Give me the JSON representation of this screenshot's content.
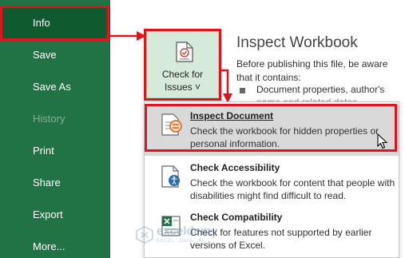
{
  "nav": {
    "items": [
      {
        "label": "Info",
        "state": "selected"
      },
      {
        "label": "Save",
        "state": "enabled"
      },
      {
        "label": "Save As",
        "state": "enabled"
      },
      {
        "label": "History",
        "state": "disabled"
      },
      {
        "label": "Print",
        "state": "enabled"
      },
      {
        "label": "Share",
        "state": "enabled"
      },
      {
        "label": "Export",
        "state": "enabled"
      },
      {
        "label": "More...",
        "state": "enabled"
      }
    ]
  },
  "check_issues": {
    "label_line1": "Check for",
    "label_line2": "Issues ˅",
    "icon": "document-checklist-icon"
  },
  "inspect": {
    "title": "Inspect Workbook",
    "description": "Before publishing this file, be aware that it contains:",
    "bullet": "Document properties, author's",
    "bullet_partial": "name and related dates"
  },
  "menu": {
    "items": [
      {
        "title": "Inspect Document",
        "description": "Check the workbook for hidden properties or personal information.",
        "icon": "inspect-document-icon",
        "highlighted": true
      },
      {
        "title": "Check Accessibility",
        "description": "Check the workbook for content that people with disabilities might find difficult to read.",
        "icon": "accessibility-icon",
        "highlighted": false
      },
      {
        "title": "Check Compatibility",
        "description": "Check for features not supported by earlier versions of Excel.",
        "icon": "compatibility-icon",
        "highlighted": false
      }
    ]
  },
  "watermark": {
    "name": "exceldemy",
    "tagline": "EXCEL · DATA · BI"
  },
  "colors": {
    "nav_bg": "#217346",
    "nav_selected": "#0f5a2e",
    "annotation_red": "#e0141e",
    "tile_bg": "#d6ead9",
    "menu_highlight": "#d9d9d9"
  }
}
